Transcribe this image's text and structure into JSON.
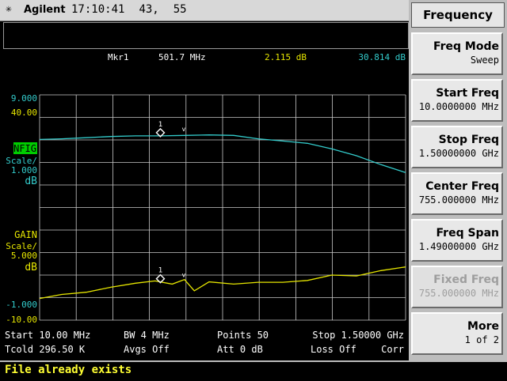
{
  "header": {
    "logo_glyph": "✳",
    "brand": "Agilent",
    "time": "17:10:41",
    "field_a": "43,",
    "field_b": "55"
  },
  "marker": {
    "label": "Mkr1",
    "freq": "501.7 MHz",
    "gain_value": "2.115 dB",
    "nfig_value": "30.814 dB"
  },
  "scales": {
    "nfig": {
      "ref_top": "9.000",
      "ref_top2": "40.00",
      "name": "NFIG",
      "scale_label": "Scale/",
      "scale_value": "1.000",
      "unit": "dB"
    },
    "gain": {
      "name": "GAIN",
      "scale_label": "Scale/",
      "scale_value": "5.000",
      "unit": "dB",
      "bottom1": "-1.000",
      "bottom2": "-10.00"
    }
  },
  "info": {
    "start": "Start 10.00 MHz",
    "bw": "BW 4 MHz",
    "points": "Points 50",
    "stop": "Stop 1.50000 GHz",
    "tcold": "Tcold 296.50 K",
    "avgs": "Avgs Off",
    "att": "Att 0 dB",
    "loss": "Loss Off",
    "corr": "Corr"
  },
  "status": {
    "message": "File already exists"
  },
  "menu": {
    "title": "Frequency",
    "keys": [
      {
        "label": "Freq Mode",
        "value": "Sweep",
        "enabled": true
      },
      {
        "label": "Start Freq",
        "value": "10.0000000 MHz",
        "enabled": true
      },
      {
        "label": "Stop Freq",
        "value": "1.50000000 GHz",
        "enabled": true
      },
      {
        "label": "Center Freq",
        "value": "755.000000 MHz",
        "enabled": true
      },
      {
        "label": "Freq Span",
        "value": "1.49000000 GHz",
        "enabled": true
      },
      {
        "label": "Fixed Freq",
        "value": "755.000000 MHz",
        "enabled": false
      },
      {
        "label": "More",
        "value": "1 of 2",
        "enabled": true
      }
    ]
  },
  "colors": {
    "nfig_trace": "#33cccc",
    "gain_trace": "#e6e600",
    "grid": "#c8c8c8",
    "marker_readout": "#ffffff",
    "nfig_label_bg": "#00cc00"
  },
  "chart_data": {
    "type": "line",
    "x_unit": "MHz",
    "xlim": [
      10,
      1500
    ],
    "marker_freq": 501.7,
    "series": [
      {
        "name": "NFIG",
        "ylim": [
          0,
          10
        ],
        "x": [
          10,
          100,
          200,
          300,
          400,
          500,
          600,
          700,
          800,
          900,
          1000,
          1100,
          1200,
          1300,
          1400,
          1500
        ],
        "values": [
          8.02,
          8.05,
          8.1,
          8.15,
          8.18,
          8.18,
          8.2,
          8.22,
          8.2,
          8.05,
          7.95,
          7.85,
          7.6,
          7.3,
          6.9,
          6.55
        ]
      },
      {
        "name": "GAIN",
        "ylim": [
          -10,
          40
        ],
        "x": [
          10,
          100,
          200,
          300,
          400,
          480,
          550,
          600,
          640,
          700,
          800,
          900,
          1000,
          1100,
          1200,
          1300,
          1400,
          1500
        ],
        "values": [
          -5.2,
          -4.3,
          -3.8,
          -2.7,
          -1.8,
          -1.3,
          -2,
          -1,
          -3.5,
          -1.5,
          -2,
          -1.6,
          -1.6,
          -1.2,
          0,
          -0.2,
          1,
          1.8
        ]
      }
    ]
  }
}
